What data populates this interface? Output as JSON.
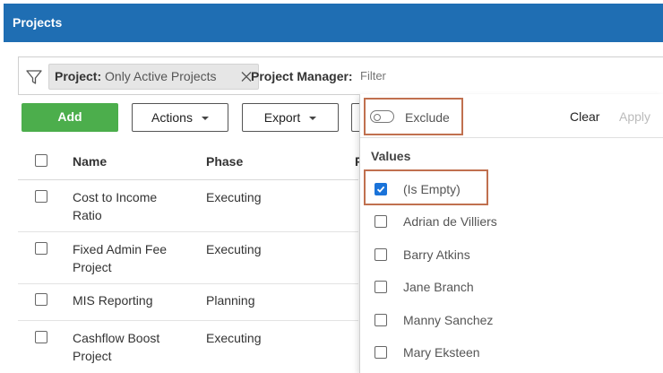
{
  "header": {
    "title": "Projects"
  },
  "filter_bar": {
    "chip_field": "Project:",
    "chip_value": "Only Active Projects",
    "pm_label": "Project Manager:",
    "pm_placeholder": "Filter"
  },
  "toolbar": {
    "add_label": "Add",
    "actions_label": "Actions",
    "export_label": "Export"
  },
  "table": {
    "columns": [
      "Name",
      "Phase"
    ],
    "rows": [
      {
        "name": "Cost to Income Ratio",
        "name_line1": "Cost to Income",
        "name_line2": "Ratio",
        "phase": "Executing"
      },
      {
        "name": "Fixed Admin Fee Project",
        "name_line1": "Fixed Admin Fee",
        "name_line2": "Project",
        "phase": "Executing"
      },
      {
        "name": "MIS Reporting",
        "name_line1": "MIS Reporting",
        "name_line2": "",
        "phase": "Planning"
      },
      {
        "name": "Cashflow Boost Project",
        "name_line1": "Cashflow Boost",
        "name_line2": "Project",
        "phase": "Executing"
      }
    ]
  },
  "dropdown": {
    "exclude_label": "Exclude",
    "exclude_on": false,
    "clear_label": "Clear",
    "apply_label": "Apply",
    "values_heading": "Values",
    "values": [
      {
        "label": "(Is Empty)",
        "checked": true
      },
      {
        "label": "Adrian de Villiers",
        "checked": false
      },
      {
        "label": "Barry Atkins",
        "checked": false
      },
      {
        "label": "Jane Branch",
        "checked": false
      },
      {
        "label": "Manny Sanchez",
        "checked": false
      },
      {
        "label": "Mary Eksteen",
        "checked": false
      }
    ]
  },
  "colors": {
    "header_bg": "#1f6eb3",
    "add_button_bg": "#4cae4c",
    "checkbox_checked": "#1a73d9",
    "highlight_border": "#c0704f"
  }
}
